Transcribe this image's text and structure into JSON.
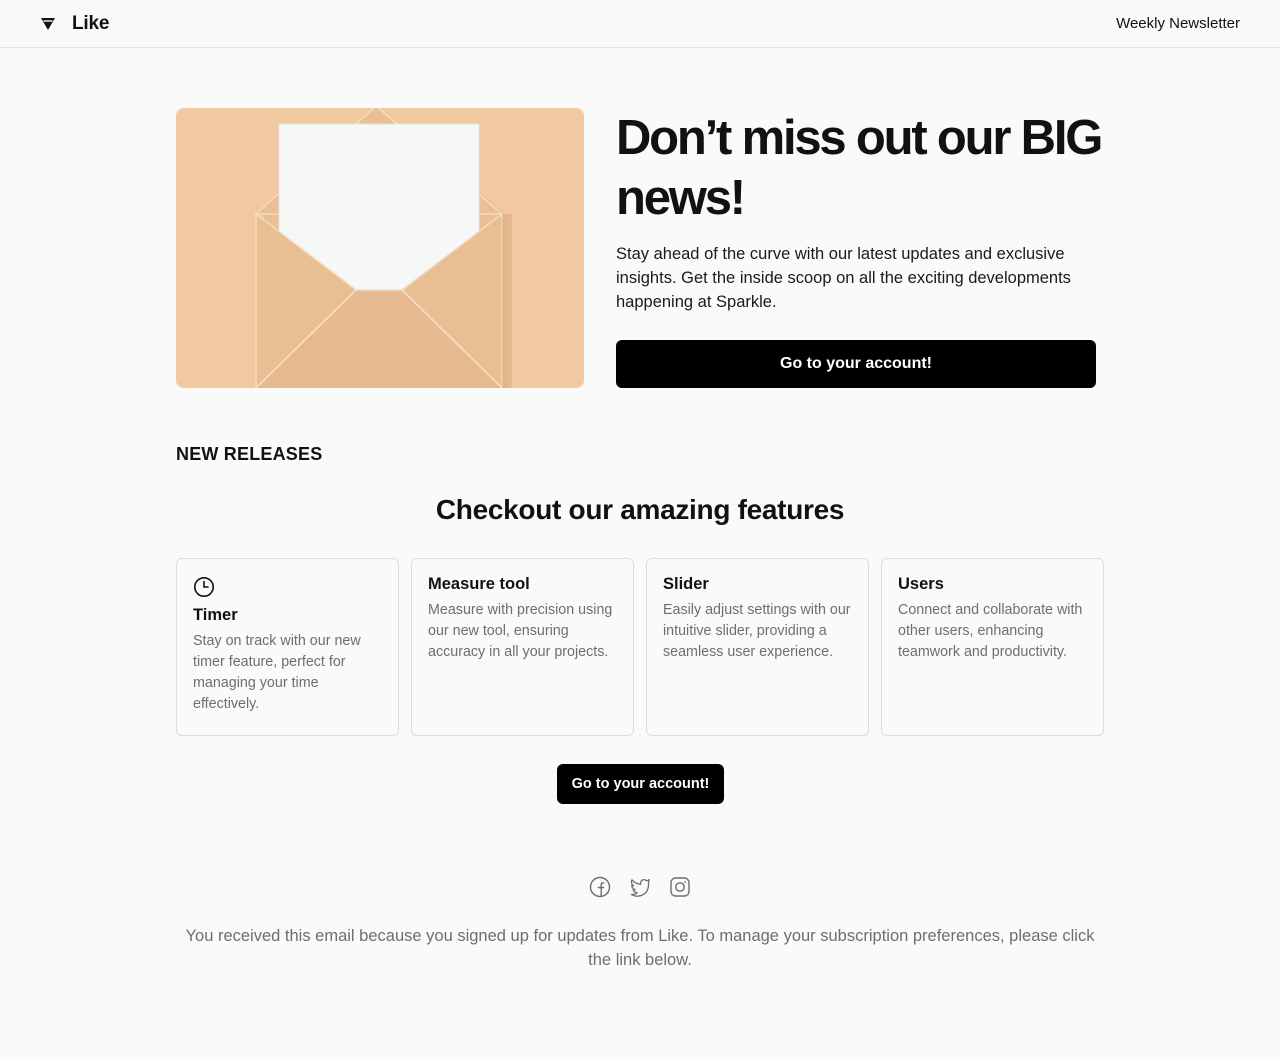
{
  "header": {
    "brand_name": "Like",
    "logo_icon": "like-logo-icon",
    "right_link": "Weekly Newsletter"
  },
  "hero": {
    "image_icon": "envelope-illustration",
    "title": "Don’t miss out our BIG news!",
    "text": "Stay ahead of the curve with our latest updates and exclusive insights. Get the inside scoop on all the exciting developments happening at Sparkle.",
    "button_label": "Go to your account!"
  },
  "releases": {
    "label": "NEW RELEASES",
    "title": "Checkout our amazing features",
    "cards": [
      {
        "icon": "clock-icon",
        "title": "Timer",
        "text": "Stay on track with our new timer feature, perfect for managing your time effectively."
      },
      {
        "title": "Measure tool",
        "text": "Measure with precision using our new tool, ensuring accuracy in all your projects."
      },
      {
        "title": "Slider",
        "text": "Easily adjust settings with our intuitive slider, providing a seamless user experience."
      },
      {
        "title": "Users",
        "text": "Connect and collaborate with other users, enhancing teamwork and productivity."
      }
    ],
    "button_label": "Go to your account!"
  },
  "footer": {
    "social_icons": [
      "facebook-icon",
      "twitter-icon",
      "instagram-icon"
    ],
    "text": "You received this email because you signed up for updates from Like. To manage your subscription preferences, please click the link below."
  },
  "colors": {
    "background": "#fafafa",
    "accent": "#000000",
    "hero_image_bg": "#f0c9a0",
    "muted_text": "#6e6e6e"
  }
}
